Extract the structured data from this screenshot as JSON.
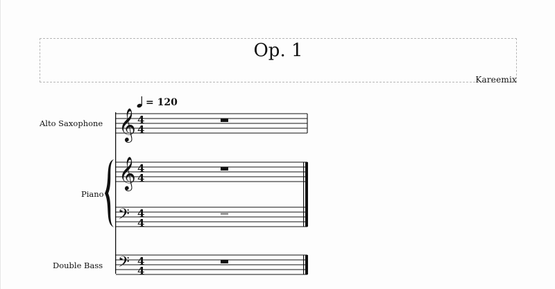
{
  "score": {
    "title": "Op. 1",
    "composer": "Kareemix"
  },
  "tempo": {
    "note_icon": "quarter-note-icon",
    "text": "= 120"
  },
  "instruments": [
    {
      "label": "Alto Saxophone",
      "clef": "treble",
      "time_signature": "4/4"
    },
    {
      "label": "Piano",
      "clef": "treble+bass",
      "time_signature": "4/4"
    },
    {
      "label": "Double Bass",
      "clef": "bass",
      "time_signature": "4/4"
    }
  ],
  "time_signature": {
    "top": "4",
    "bottom": "4"
  },
  "icons": {
    "treble_clef": "treble-clef-icon",
    "bass_clef": "bass-clef-icon",
    "whole_rest": "whole-rest-icon",
    "brace": "brace-icon"
  },
  "colors": {
    "staff_line": "#111111",
    "selection_frame": "#b5b5b5",
    "page": "#fdfdfd"
  }
}
